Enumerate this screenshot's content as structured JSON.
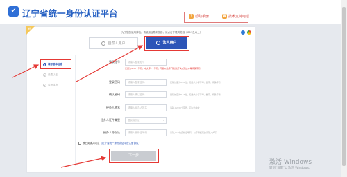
{
  "header": {
    "logo_icon": "✔",
    "title": "辽宁省统一身份认证平台",
    "help": "帮助手册",
    "support": "技术支持电话"
  },
  "card": {
    "corner_text": "新",
    "notice": "为了您的使用体验，请使用谷歌浏览器，请点击下载浏览器（IE11及以上）",
    "tabs": {
      "person": "自然人用户",
      "legal": "法人用户"
    }
  },
  "steps": [
    {
      "num": "1",
      "label": "填写基本信息"
    },
    {
      "num": "2",
      "label": "设置认证"
    },
    {
      "num": "3",
      "label": "注册成功"
    }
  ],
  "form": {
    "rows": [
      {
        "label": "登录账号",
        "placeholder": "请输入登录账号",
        "hint": "",
        "sub": "长度为4-30个字符，中文算2个字符，不能以数字/下划线开头或包含@等特殊字符"
      },
      {
        "label": "登录密码",
        "placeholder": "请输入登录密码",
        "hint": "密码长度为8-16位，包含大小写字母、数字、特殊字符",
        "sub": ""
      },
      {
        "label": "确认密码",
        "placeholder": "请输入确认密码",
        "hint": "密码长度为8-16位，包含大小写字母、数字、特殊字符",
        "sub": ""
      },
      {
        "label": "经办人姓名",
        "placeholder": "请输入经办人姓名",
        "hint": "请输入2-30个字符，可以为中文",
        "sub": ""
      },
      {
        "label": "经办人证件类型",
        "placeholder": "居民身份证",
        "hint": "",
        "sub": ""
      },
      {
        "label": "经办人身份证",
        "placeholder": "请输入身份证号码",
        "hint": "请输入18位身份证号码，以字母结尾的请输入大写",
        "sub": ""
      }
    ],
    "agree_prefix": "我已阅读并同意",
    "agree_link": "《辽宁省统一身份认证平台注册协议》",
    "next_button": "下一步"
  },
  "watermark": {
    "title": "激活 Windows",
    "subtitle": "转到\"设置\"以激活 Windows。"
  },
  "colors": {
    "primary": "#2c55b8",
    "highlight": "#e53935",
    "warning": "#f2a540"
  }
}
